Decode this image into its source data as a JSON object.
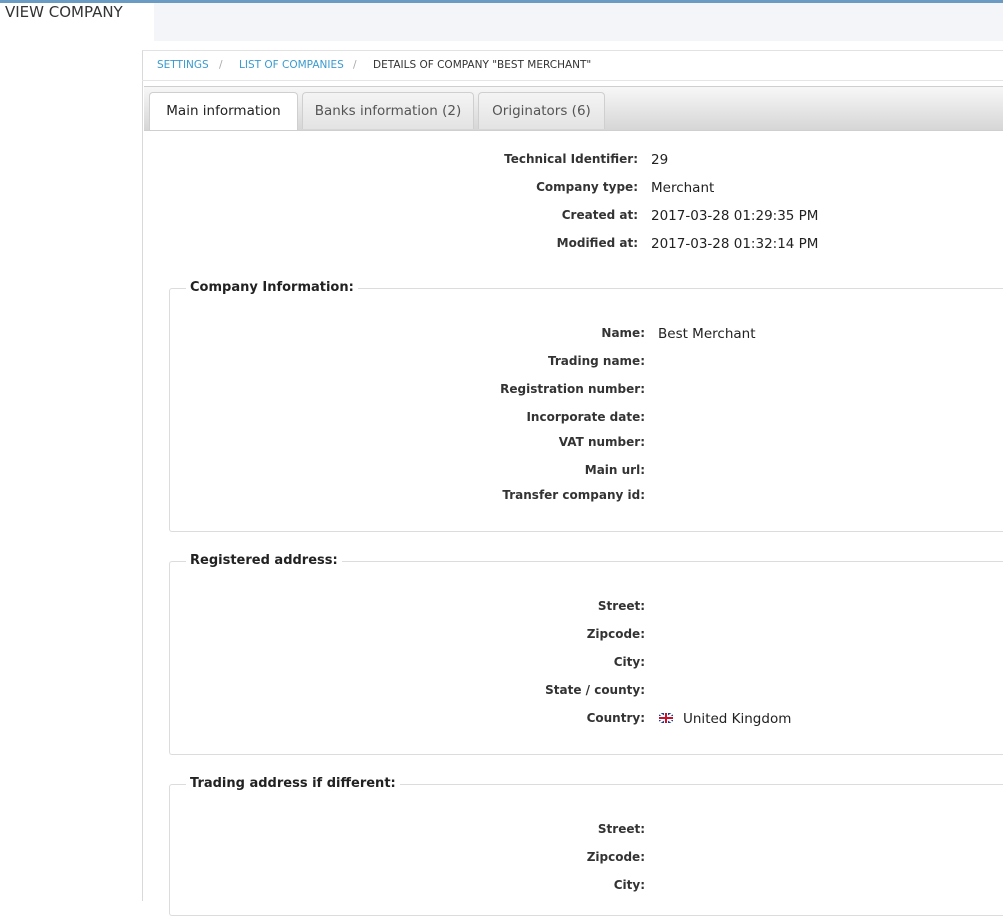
{
  "page": {
    "title": "VIEW COMPANY"
  },
  "breadcrumb": {
    "items": [
      "SETTINGS",
      "LIST OF COMPANIES"
    ],
    "separator": "/",
    "current": "DETAILS OF COMPANY \"BEST MERCHANT\""
  },
  "tabs": [
    {
      "label": "Main information",
      "active": true
    },
    {
      "label": "Banks information (2)",
      "active": false
    },
    {
      "label": "Originators (6)",
      "active": false
    }
  ],
  "summary": {
    "technical_identifier": {
      "label": "Technical Identifier:",
      "value": "29"
    },
    "company_type": {
      "label": "Company type:",
      "value": "Merchant"
    },
    "created_at": {
      "label": "Created at:",
      "value": "2017-03-28 01:29:35 PM"
    },
    "modified_at": {
      "label": "Modified at:",
      "value": "2017-03-28 01:32:14 PM"
    }
  },
  "company_information": {
    "legend": "Company Information:",
    "name": {
      "label": "Name:",
      "value": "Best Merchant"
    },
    "trading_name": {
      "label": "Trading name:",
      "value": ""
    },
    "registration_number": {
      "label": "Registration number:",
      "value": ""
    },
    "incorporate_date": {
      "label": "Incorporate date:",
      "value": ""
    },
    "vat_number": {
      "label": "VAT number:",
      "value": ""
    },
    "main_url": {
      "label": "Main url:",
      "value": ""
    },
    "transfer_company_id": {
      "label": "Transfer company id:",
      "value": ""
    }
  },
  "registered_address": {
    "legend": "Registered address:",
    "street": {
      "label": "Street:",
      "value": ""
    },
    "zipcode": {
      "label": "Zipcode:",
      "value": ""
    },
    "city": {
      "label": "City:",
      "value": ""
    },
    "state_county": {
      "label": "State / county:",
      "value": ""
    },
    "country": {
      "label": "Country:",
      "value": "United Kingdom",
      "icon": "uk-flag-icon"
    }
  },
  "trading_address": {
    "legend": "Trading address if different:",
    "street": {
      "label": "Street:",
      "value": ""
    },
    "zipcode": {
      "label": "Zipcode:",
      "value": ""
    },
    "city": {
      "label": "City:",
      "value": ""
    }
  },
  "colors": {
    "accent_line": "#6b9bc3",
    "link": "#3a9ad0",
    "header_band": "#f3f5f8"
  }
}
